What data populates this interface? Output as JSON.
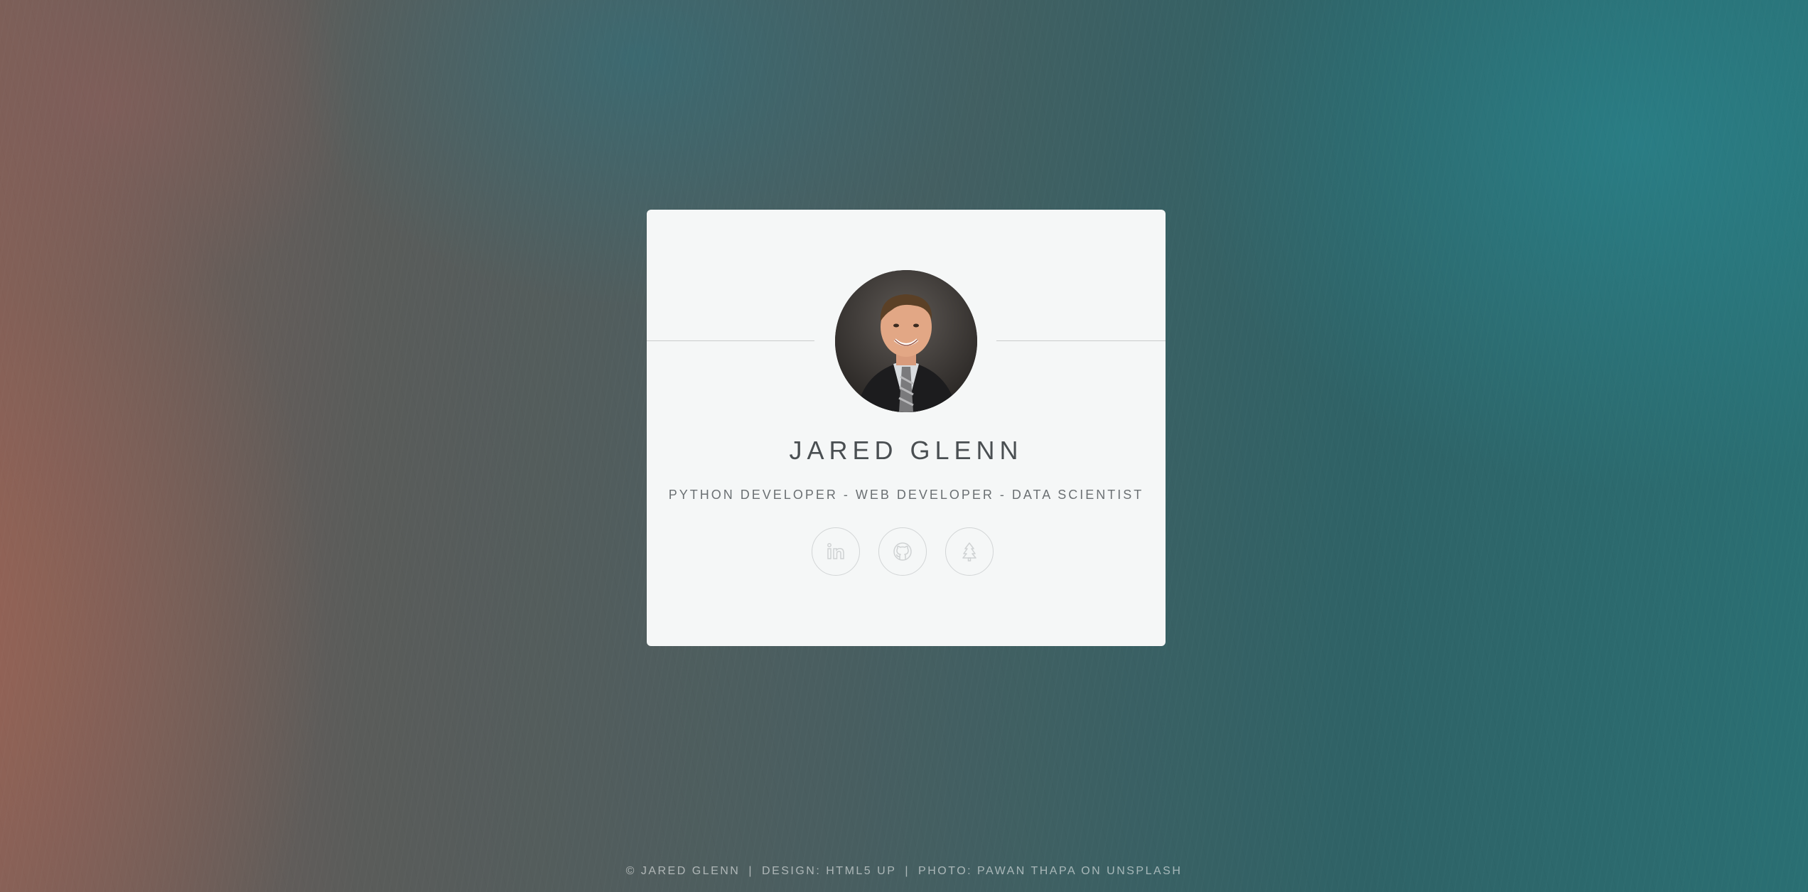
{
  "profile": {
    "name": "JARED GLENN",
    "tagline": "PYTHON DEVELOPER - WEB DEVELOPER - DATA SCIENTIST",
    "avatar_alt": "Jared Glenn portrait"
  },
  "social": [
    {
      "name": "linkedin",
      "icon": "linkedin-icon"
    },
    {
      "name": "github",
      "icon": "github-icon"
    },
    {
      "name": "linktree",
      "icon": "tree-icon"
    }
  ],
  "footer": {
    "copyright": "© JARED GLENN",
    "design": "DESIGN: HTML5 UP",
    "photo": "PHOTO: PAWAN THAPA ON UNSPLASH",
    "separator": "|"
  },
  "colors": {
    "card_bg": "#f5f7f7",
    "icon_stroke": "#d2d5d6",
    "text_dark": "#4a4f52"
  }
}
